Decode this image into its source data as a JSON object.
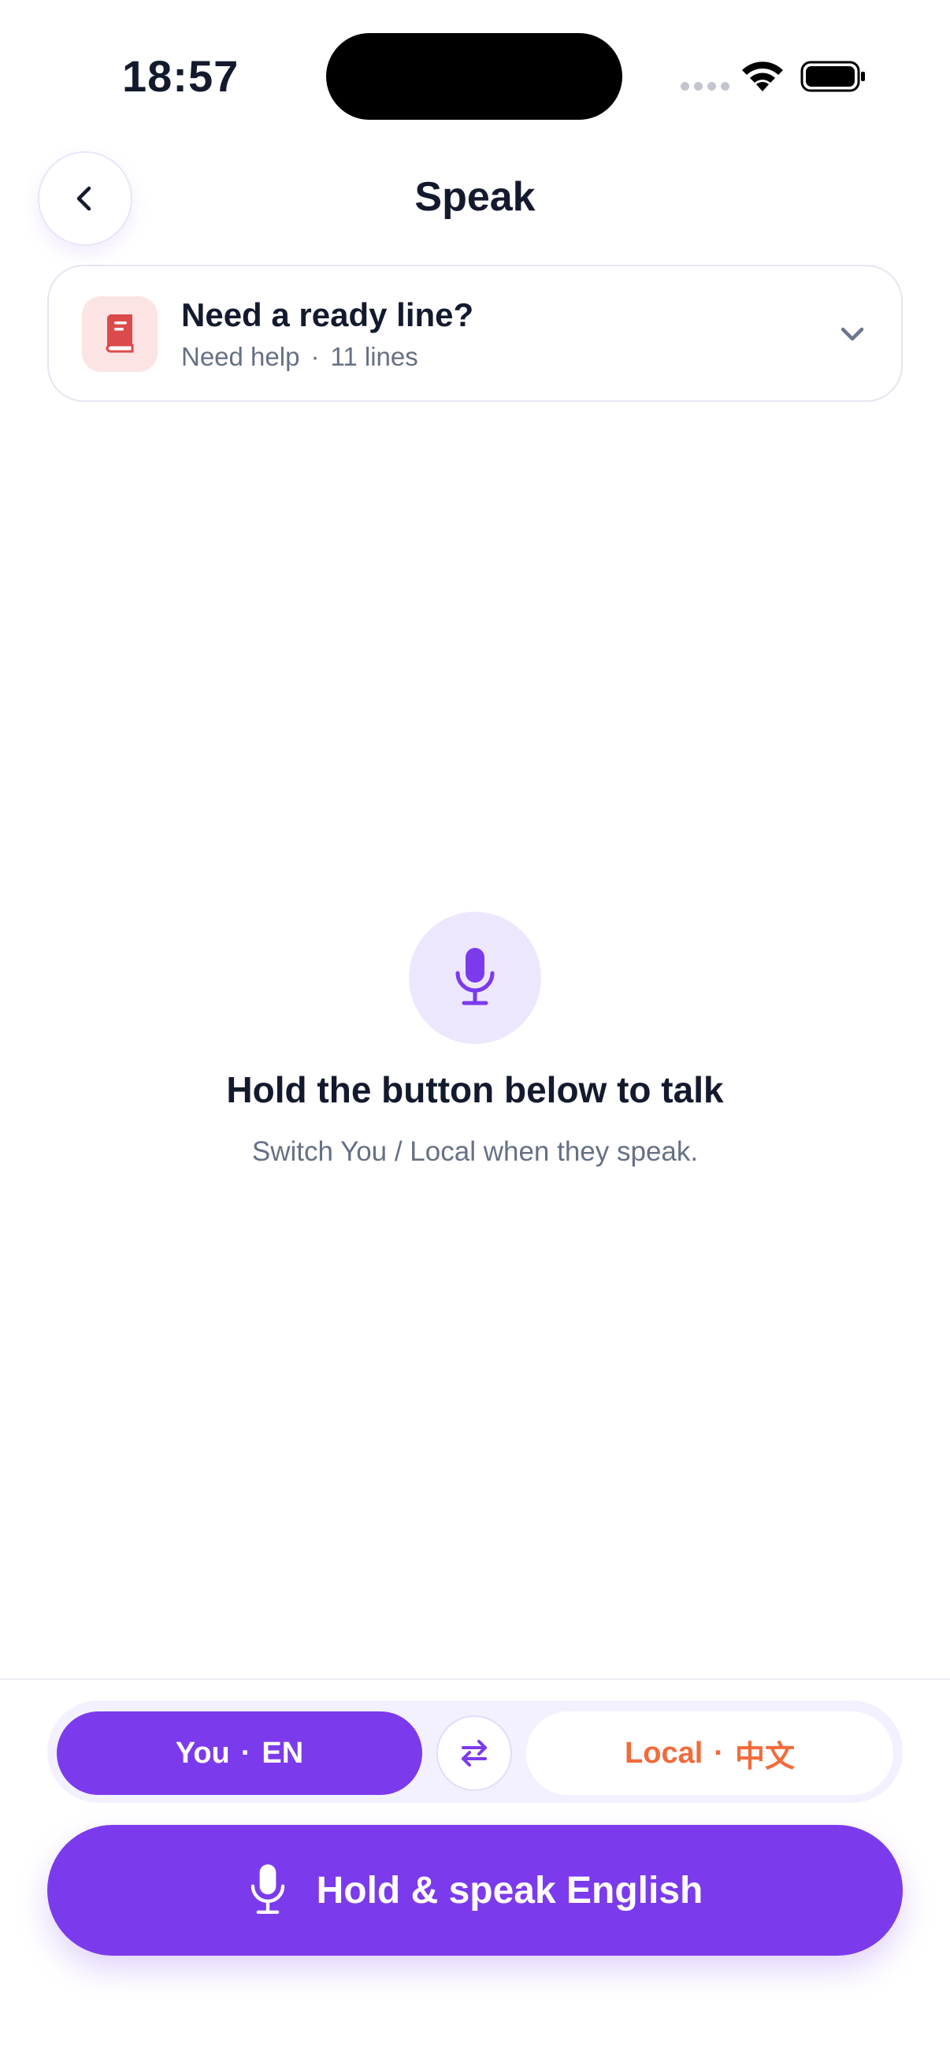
{
  "status_bar": {
    "time": "18:57"
  },
  "header": {
    "title": "Speak",
    "back_icon": "chevron-left-icon"
  },
  "ready_card": {
    "icon": "book-icon",
    "title": "Need a ready line?",
    "category": "Need help",
    "separator": "·",
    "count": "11 lines",
    "expand_icon": "chevron-down-icon"
  },
  "empty_state": {
    "icon": "microphone-icon",
    "title": "Hold the button below to talk",
    "subtitle": "Switch You / Local when they speak."
  },
  "language_toggle": {
    "you_label": "You",
    "you_lang": "EN",
    "local_label": "Local",
    "local_lang": "中文",
    "separator": "·",
    "swap_icon": "swap-arrows-icon",
    "active": "you"
  },
  "hold_button": {
    "label": "Hold & speak English",
    "icon": "microphone-icon"
  },
  "colors": {
    "accent": "#7C3AED",
    "local_accent": "#F26B3A",
    "book_icon": "#DC4B4B"
  }
}
